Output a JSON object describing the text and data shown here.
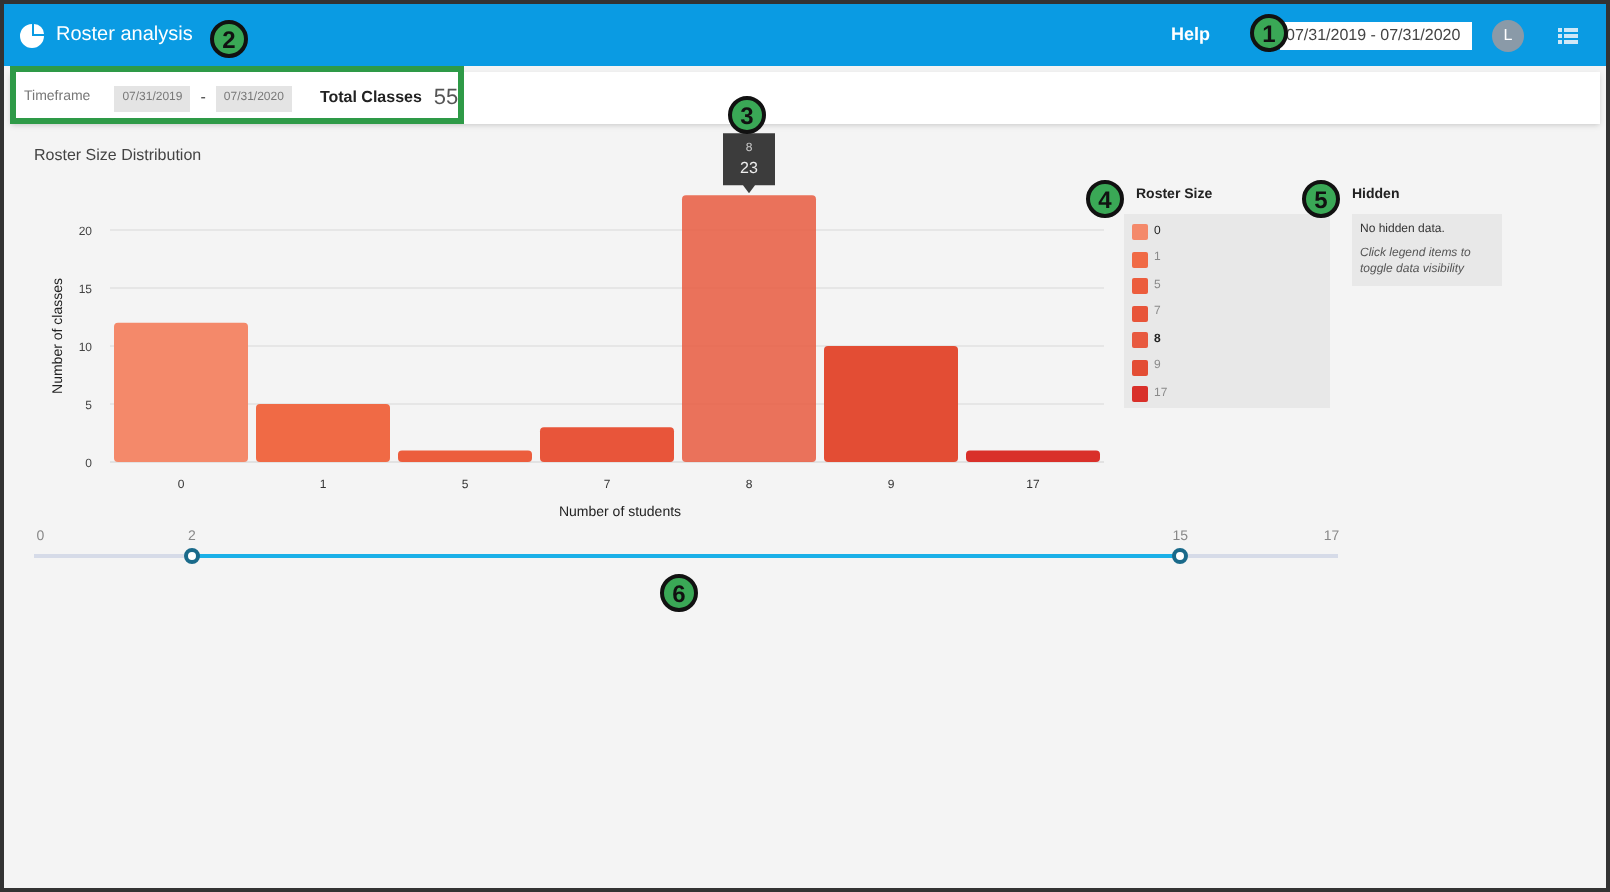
{
  "header": {
    "title": "Roster analysis",
    "help_link": "Help",
    "date_range": "07/31/2019 - 07/31/2020",
    "avatar_initial": "L"
  },
  "filter_bar": {
    "timeframe_label": "Timeframe",
    "start_date": "07/31/2019",
    "separator": "-",
    "end_date": "07/31/2020",
    "total_label": "Total Classes",
    "total_value": "55"
  },
  "chart_panel": {
    "chart_data": {
      "type": "bar",
      "title": "Roster Size Distribution",
      "xlabel": "Number of students",
      "ylabel": "Number of classes",
      "categories": [
        "0",
        "1",
        "5",
        "7",
        "8",
        "9",
        "17"
      ],
      "values": [
        12,
        5,
        1,
        3,
        23,
        10,
        1
      ],
      "ylim": [
        0,
        23
      ],
      "grid": true,
      "yticks": [
        0,
        5,
        10,
        15,
        20
      ]
    },
    "tooltip": {
      "category": "8",
      "value": "23"
    }
  },
  "legend": {
    "title": "Roster Size",
    "items": [
      {
        "label": "0",
        "color": "#f4896a",
        "dimmed": false,
        "hovered": false
      },
      {
        "label": "1",
        "color": "#f06a45",
        "dimmed": true,
        "hovered": false
      },
      {
        "label": "5",
        "color": "#ec5d3d",
        "dimmed": true,
        "hovered": false
      },
      {
        "label": "7",
        "color": "#e8553a",
        "dimmed": true,
        "hovered": false
      },
      {
        "label": "8",
        "color": "#e85a40",
        "dimmed": false,
        "hovered": true
      },
      {
        "label": "9",
        "color": "#e34d34",
        "dimmed": true,
        "hovered": false
      },
      {
        "label": "17",
        "color": "#d9302a",
        "dimmed": true,
        "hovered": false
      }
    ]
  },
  "hidden_panel": {
    "title": "Hidden",
    "message": "No hidden data.",
    "hint": "Click legend items to toggle data visibility"
  },
  "range_slider": {
    "min_label": "0",
    "max_label": "17",
    "thumbs": [
      {
        "label": "2",
        "level": 0.121
      },
      {
        "label": "15",
        "level": 0.879
      }
    ]
  },
  "annotations": [
    {
      "number": "1"
    },
    {
      "number": "2"
    },
    {
      "number": "3"
    },
    {
      "number": "4"
    },
    {
      "number": "5"
    },
    {
      "number": "6"
    }
  ]
}
